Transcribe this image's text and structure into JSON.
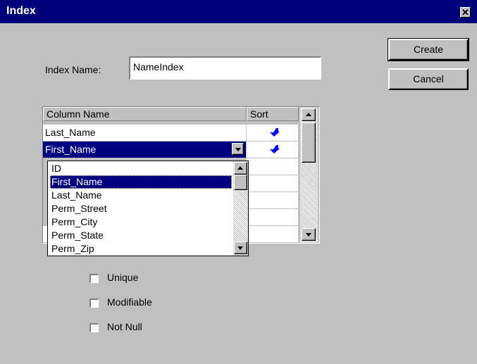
{
  "window": {
    "title": "Index",
    "close_symbol": "✕"
  },
  "index_name": {
    "label": "Index Name:",
    "value": "NameIndex"
  },
  "buttons": {
    "create": "Create",
    "cancel": "Cancel"
  },
  "grid": {
    "headers": [
      "Column Name",
      "Sort"
    ],
    "rows": [
      {
        "column": "Last_Name",
        "sort": "descending-arrow-icon"
      },
      {
        "column": "First_Name",
        "sort": "descending-arrow-icon",
        "selected": true
      }
    ]
  },
  "dropdown": {
    "items": [
      "ID",
      "First_Name",
      "Last_Name",
      "Perm_Street",
      "Perm_City",
      "Perm_State",
      "Perm_Zip"
    ],
    "selected_index": 1
  },
  "checkboxes": [
    {
      "label": "Unique",
      "checked": false
    },
    {
      "label": "Modifiable",
      "checked": false
    },
    {
      "label": "Not Null",
      "checked": false
    }
  ],
  "colors": {
    "titlebar": "#00007b",
    "selection": "#000080",
    "face": "#c0c0c0",
    "arrow": "#0000ff"
  }
}
